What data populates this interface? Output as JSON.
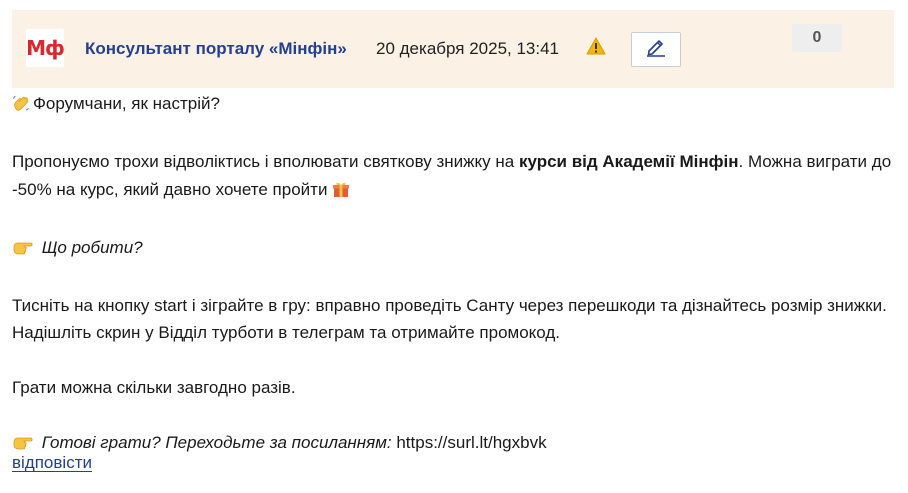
{
  "header": {
    "avatar_text": "Мф",
    "author": "Консультант порталу «Мінфін»",
    "date": "20 декабря 2025, 13:41",
    "rating": "0"
  },
  "icons": {
    "wave": "waving-hand-icon",
    "warning": "warning-icon",
    "edit": "pencil-icon",
    "gift": "gift-icon",
    "pointer": "pointing-hand-icon"
  },
  "colors": {
    "header_bg": "#fbf1e4",
    "link": "#24408e",
    "brand_red": "#d9272e",
    "warning": "#f2b807"
  },
  "body": {
    "greeting": "Форумчани, як настрій?",
    "p2_part1": "Пропонуємо трохи відволіктись і вполювати святкову знижку на ",
    "p2_bold": "курси від Академії Мінфін",
    "p2_part2": ". Можна виграти до -50% на курс, який давно хочете пройти",
    "what_to_do": "Що робити?",
    "instructions": "Тисніть на кнопку start і зіграйте в гру: вправно проведіть Санту через перешкоди та дізнайтесь розмір знижки. Надішліть скрин у Відділ турботи в телеграм та отримайте промокод.",
    "play_note": "Грати можна скільки завгодно разів.",
    "ready_italic": "Готові грати? Переходьте за посиланням:",
    "link_url": "https://surl.lt/hgxbvk"
  },
  "actions": {
    "reply": "відповісти"
  }
}
